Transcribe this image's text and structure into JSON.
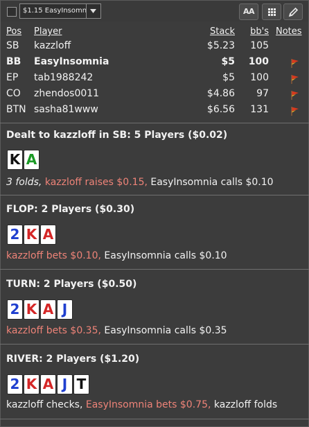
{
  "toolbar": {
    "hand_select_value": "$1.15 EasyInsomnia",
    "font_button_label": "AA"
  },
  "table_header": {
    "pos": "Pos",
    "player": "Player",
    "stack": "Stack",
    "bbs": "bb's",
    "notes": "Notes"
  },
  "players": [
    {
      "pos": "SB",
      "player": "kazzloff",
      "stack": "$5.23",
      "bbs": "105",
      "note": false
    },
    {
      "pos": "BB",
      "player": "EasyInsomnia",
      "stack": "$5",
      "bbs": "100",
      "note": true
    },
    {
      "pos": "EP",
      "player": "tab1988242",
      "stack": "$5",
      "bbs": "100",
      "note": true
    },
    {
      "pos": "CO",
      "player": "zhendos0011",
      "stack": "$4.86",
      "bbs": "97",
      "note": true
    },
    {
      "pos": "BTN",
      "player": "sasha81www",
      "stack": "$6.56",
      "bbs": "131",
      "note": true
    }
  ],
  "colors": {
    "background": "#3c3c3c",
    "aggressive_action": "#ee8378",
    "note_flag": "#d93a1e",
    "card_blue": "#1f3fcf",
    "card_red": "#d42626",
    "card_green": "#1d9a27",
    "card_black": "#111111"
  },
  "streets": [
    {
      "title": "Dealt to kazzloff in SB: 5 Players ($0.02)",
      "cards": [
        {
          "rank": "K",
          "color": "black"
        },
        {
          "rank": "A",
          "color": "green"
        }
      ],
      "actions": [
        {
          "text": "3 folds, ",
          "type": "fold"
        },
        {
          "text": "kazzloff raises $0.15, ",
          "type": "aggr"
        },
        {
          "text": "EasyInsomnia calls $0.10",
          "type": "norm"
        }
      ]
    },
    {
      "title": "FLOP: 2 Players ($0.30)",
      "cards": [
        {
          "rank": "2",
          "color": "blue"
        },
        {
          "rank": "K",
          "color": "red"
        },
        {
          "rank": "A",
          "color": "red"
        }
      ],
      "actions": [
        {
          "text": "kazzloff bets $0.10, ",
          "type": "aggr"
        },
        {
          "text": "EasyInsomnia calls $0.10",
          "type": "norm"
        }
      ]
    },
    {
      "title": "TURN: 2 Players ($0.50)",
      "cards": [
        {
          "rank": "2",
          "color": "blue"
        },
        {
          "rank": "K",
          "color": "red"
        },
        {
          "rank": "A",
          "color": "red"
        },
        {
          "rank": "J",
          "color": "blue"
        }
      ],
      "actions": [
        {
          "text": "kazzloff bets $0.35, ",
          "type": "aggr"
        },
        {
          "text": "EasyInsomnia calls $0.35",
          "type": "norm"
        }
      ]
    },
    {
      "title": "RIVER: 2 Players ($1.20)",
      "cards": [
        {
          "rank": "2",
          "color": "blue"
        },
        {
          "rank": "K",
          "color": "red"
        },
        {
          "rank": "A",
          "color": "red"
        },
        {
          "rank": "J",
          "color": "blue"
        },
        {
          "rank": "T",
          "color": "black"
        }
      ],
      "actions": [
        {
          "text": "kazzloff checks, ",
          "type": "norm"
        },
        {
          "text": "EasyInsomnia bets $0.75, ",
          "type": "aggr"
        },
        {
          "text": "kazzloff folds",
          "type": "norm"
        }
      ]
    }
  ]
}
